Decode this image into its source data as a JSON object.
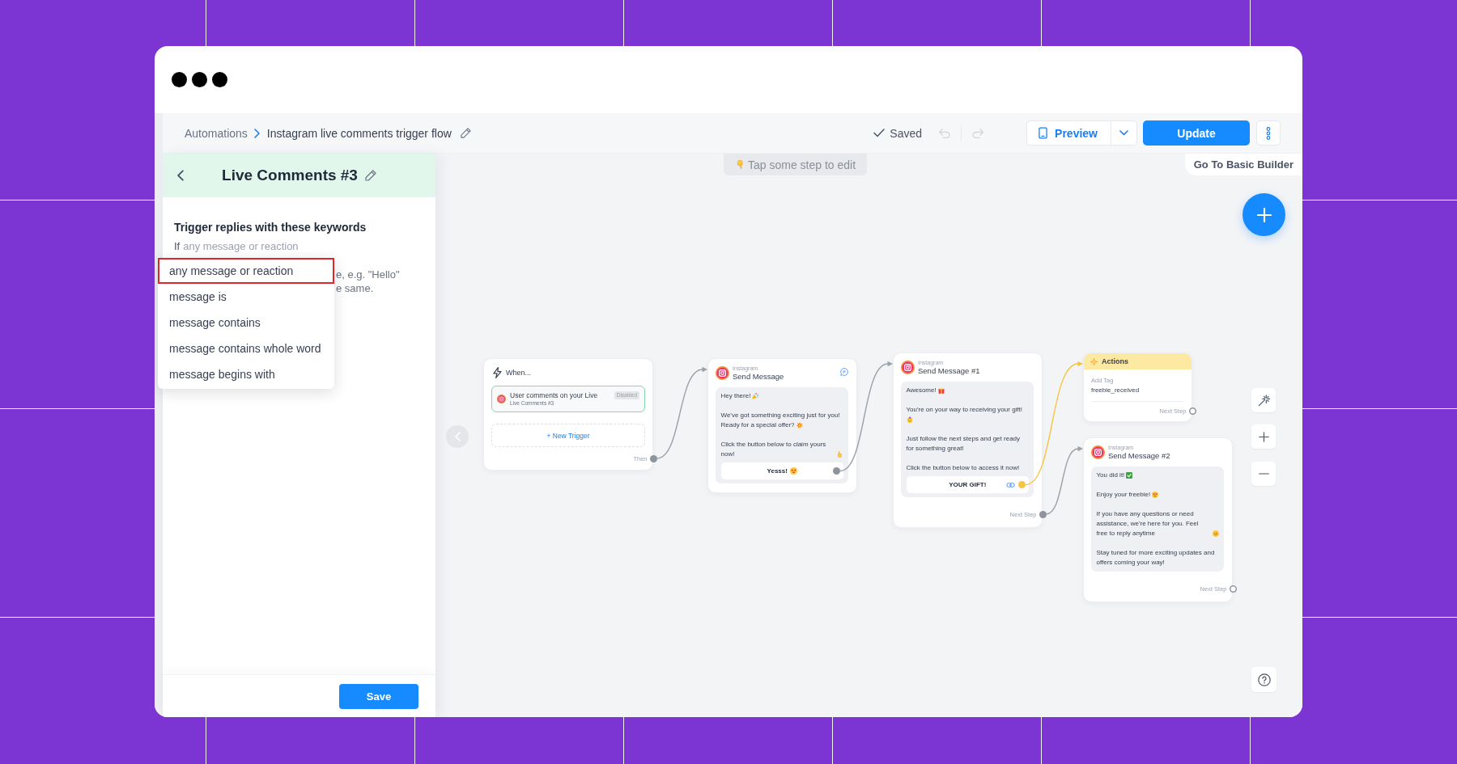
{
  "toolbar": {
    "breadcrumb": [
      {
        "label": "Automations",
        "current": false
      },
      {
        "label": "Instagram live comments trigger flow",
        "current": true
      }
    ],
    "status": "Saved",
    "undo_disabled": true,
    "redo_disabled": true,
    "preview_button": "Preview",
    "update_button": "Update"
  },
  "panel": {
    "title": "Live Comments #3",
    "heading": "Trigger replies with these keywords",
    "condition_prefix": "If",
    "condition": "any message or reaction",
    "hint": "e, e.g. \"Hello\"\ne same.",
    "save_button": "Save"
  },
  "dropdown": {
    "options": [
      {
        "label": "any message or reaction",
        "selected": true
      },
      {
        "label": "message is",
        "selected": false
      },
      {
        "label": "message contains",
        "selected": false
      },
      {
        "label": "message contains whole word",
        "selected": false
      },
      {
        "label": "message begins with",
        "selected": false
      }
    ]
  },
  "canvas": {
    "hint": {
      "kind": "pointdown",
      "text": "Tap some step to edit"
    },
    "builder_button": "Go To Basic Builder",
    "nodes": [
      {
        "kind": "trigger",
        "title": "When...",
        "trigger": {
          "title": "User comments on your Live",
          "subtitle": "Live Comments #3",
          "badge": "Disabled"
        },
        "add_trigger": "+ New Trigger",
        "output": {
          "label": "Then",
          "connected": true
        }
      },
      {
        "kind": "message",
        "channel": "Instagram",
        "title": "Send Message",
        "chat_icon": true,
        "paragraphs": [
          {
            "lines": [
              {
                "kind": "party",
                "text": "Hey there!"
              }
            ]
          },
          {
            "lines": [
              {
                "kind": "plain",
                "text": "We've got something exciting just for you!"
              },
              {
                "kind": "burst",
                "text": "Ready for a special offer?"
              }
            ]
          },
          {
            "lines": [
              {
                "kind": "pointup",
                "text": "Click the button below to claim yours now!"
              }
            ]
          }
        ],
        "button": {
          "label": "Yesss!",
          "kind": "starstruck",
          "connected": true
        }
      },
      {
        "kind": "message",
        "channel": "Instagram",
        "title": "Send Message #1",
        "paragraphs": [
          {
            "lines": [
              {
                "kind": "gift",
                "text": "Awesome!"
              }
            ]
          },
          {
            "lines": [
              {
                "kind": "plain",
                "text": "You're on your way to receiving your gift!"
              },
              {
                "kind": "partying"
              }
            ]
          },
          {
            "lines": [
              {
                "kind": "plain",
                "text": "Just follow the next steps and get ready for something great!"
              }
            ]
          },
          {
            "lines": [
              {
                "kind": "plain",
                "text": "Click the button below to access it now!"
              }
            ]
          }
        ],
        "button": {
          "label": "YOUR GIFT!",
          "kind": "plain",
          "has_link": true,
          "connected": true,
          "color": "#f6c445"
        },
        "output": {
          "label": "Next Step",
          "connected": true
        }
      },
      {
        "kind": "actions",
        "title": "Actions",
        "action": "Add Tag",
        "value": "freebie_received",
        "output": {
          "label": "Next Step",
          "connected": false
        }
      },
      {
        "kind": "message",
        "channel": "Instagram",
        "title": "Send Message #2",
        "paragraphs": [
          {
            "lines": [
              {
                "kind": "check",
                "text": "You did it!"
              }
            ]
          },
          {
            "lines": [
              {
                "kind": "hearteyes",
                "text": "Enjoy your freebie!"
              }
            ]
          },
          {
            "lines": [
              {
                "kind": "smile",
                "text": "If you have any questions or need assistance, we're here for you. Feel free to reply anytime"
              }
            ]
          },
          {
            "lines": [
              {
                "kind": "plain",
                "text": "Stay tuned for more exciting updates and offers coming your way!"
              }
            ]
          }
        ],
        "output": {
          "label": "Next Step",
          "connected": false
        }
      }
    ]
  }
}
